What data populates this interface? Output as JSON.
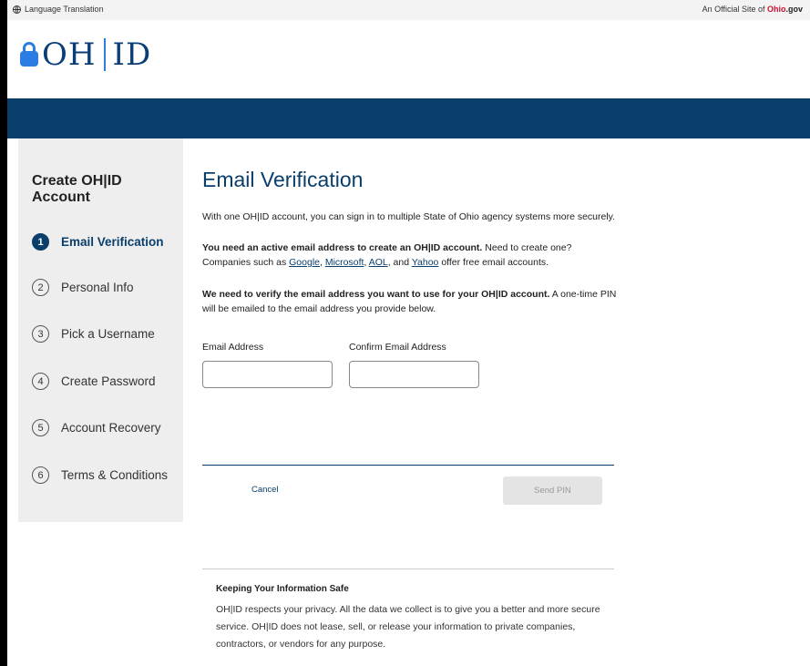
{
  "topbar": {
    "language_label": "Language Translation",
    "official_prefix": "An Official Site of ",
    "ohio_o": "O",
    "ohio_hio": "hio",
    "ohio_gov": ".gov"
  },
  "logo": {
    "left": "OH",
    "right": "ID"
  },
  "sidebar": {
    "title": "Create OH|ID Account",
    "steps": [
      {
        "num": "1",
        "label": "Email Verification"
      },
      {
        "num": "2",
        "label": "Personal Info"
      },
      {
        "num": "3",
        "label": "Pick a Username"
      },
      {
        "num": "4",
        "label": "Create Password"
      },
      {
        "num": "5",
        "label": "Account Recovery"
      },
      {
        "num": "6",
        "label": "Terms & Conditions"
      }
    ]
  },
  "main": {
    "title": "Email Verification",
    "intro": "With one OH|ID account, you can sign in to multiple State of Ohio agency systems more securely.",
    "need_bold": "You need an active email address to create an OH|ID account.",
    "need_text": " Need to create one? Companies such as ",
    "link_google": "Google",
    "comma1": ",",
    "link_microsoft": "Microsoft",
    "comma2": ", ",
    "link_aol": "AOL",
    "and_text": ", and ",
    "link_yahoo": "Yahoo",
    "need_end": " offer free email accounts.",
    "verify_bold": "We need to verify the email address you want to use for your OH|ID account.",
    "verify_text": " A one-time PIN will be emailed to the email address you provide below.",
    "email_label": "Email Address",
    "email_value": "",
    "confirm_label": "Confirm Email Address",
    "confirm_value": "",
    "cancel_label": "Cancel",
    "send_label": "Send PIN"
  },
  "safe": {
    "title": "Keeping Your Information Safe",
    "text": "OH|ID respects your privacy. All the data we collect is to give you a better and more secure service. OH|ID does not lease, sell, or release your information to private companies, contractors, or vendors for any purpose."
  },
  "colors": {
    "primary": "#0a3e6b",
    "accent": "#2b7de1",
    "ohio_red": "#c8102e"
  }
}
